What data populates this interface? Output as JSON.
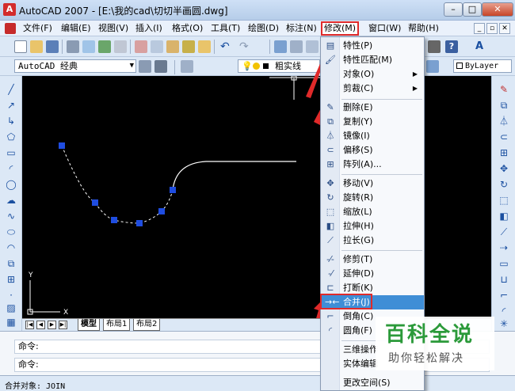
{
  "window": {
    "title": "AutoCAD 2007 - [E:\\我的cad\\切切半画圆.dwg]",
    "minimize": "–",
    "maximize": "□",
    "close": "✕"
  },
  "menubar": {
    "items": [
      "文件(F)",
      "编辑(E)",
      "视图(V)",
      "插入(I)",
      "格式(O)",
      "工具(T)",
      "绘图(D)",
      "标注(N)",
      "修改(M)",
      "窗口(W)",
      "帮助(H)"
    ],
    "active_index": 8
  },
  "toolbar": {
    "workspace": "AutoCAD 经典",
    "layer": "粗实线",
    "color": "ByLayer"
  },
  "modify_menu": {
    "items": [
      {
        "label": "特性(P)",
        "icon": "properties-icon"
      },
      {
        "label": "特性匹配(M)",
        "icon": "match-properties-icon"
      },
      {
        "label": "对象(O)",
        "icon": "",
        "submenu": true
      },
      {
        "label": "剪裁(C)",
        "icon": "",
        "submenu": true
      },
      {
        "label": "删除(E)",
        "icon": "eraser-icon"
      },
      {
        "label": "复制(Y)",
        "icon": "copy-icon"
      },
      {
        "label": "镜像(I)",
        "icon": "mirror-icon"
      },
      {
        "label": "偏移(S)",
        "icon": "offset-icon"
      },
      {
        "label": "阵列(A)...",
        "icon": "array-icon"
      },
      {
        "label": "移动(V)",
        "icon": "move-icon"
      },
      {
        "label": "旋转(R)",
        "icon": "rotate-icon"
      },
      {
        "label": "缩放(L)",
        "icon": "scale-icon"
      },
      {
        "label": "拉伸(H)",
        "icon": "stretch-icon"
      },
      {
        "label": "拉长(G)",
        "icon": "lengthen-icon"
      },
      {
        "label": "修剪(T)",
        "icon": "trim-icon"
      },
      {
        "label": "延伸(D)",
        "icon": "extend-icon"
      },
      {
        "label": "打断(K)",
        "icon": "break-icon"
      },
      {
        "label": "合并(J)",
        "icon": "join-icon",
        "highlighted": true
      },
      {
        "label": "倒角(C)",
        "icon": "chamfer-icon"
      },
      {
        "label": "圆角(F)",
        "icon": "fillet-icon"
      },
      {
        "label": "三维操作",
        "icon": ""
      },
      {
        "label": "实体编辑",
        "icon": ""
      },
      {
        "label": "更改空间(S)",
        "icon": ""
      }
    ]
  },
  "tabs": [
    "模型",
    "布局1",
    "布局2"
  ],
  "command": {
    "line1": "命令:",
    "line2": "命令:"
  },
  "status": "合并对象: JOIN",
  "watermark": {
    "logo": "百科全说",
    "sub": "助你轻松解决"
  },
  "ucs": {
    "x": "X",
    "y": "Y"
  },
  "colors": {
    "highlight": "#3f8ed6",
    "annotation": "#e02a2a",
    "canvas": "#000000",
    "grip": "#1f4de0"
  }
}
